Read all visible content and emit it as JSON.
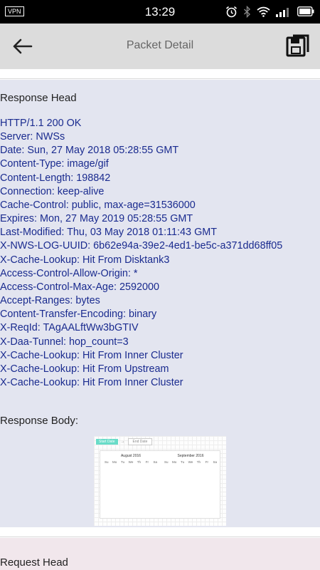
{
  "status_bar": {
    "vpn_label": "VPN",
    "time": "13:29",
    "icons": [
      "alarm-icon",
      "bluetooth-icon",
      "wifi-icon",
      "signal-icon",
      "battery-icon"
    ]
  },
  "app_bar": {
    "title": "Packet Detail",
    "back_icon": "arrow-left-icon",
    "save_icon": "save-icon"
  },
  "response": {
    "head_title": "Response Head",
    "headers": [
      "HTTP/1.1 200 OK",
      "Server: NWSs",
      "Date: Sun, 27 May 2018 05:28:55 GMT",
      "Content-Type: image/gif",
      "Content-Length: 198842",
      "Connection: keep-alive",
      "Cache-Control: public, max-age=31536000",
      "Expires: Mon, 27 May 2019 05:28:55 GMT",
      "Last-Modified: Thu, 03 May 2018 01:11:43 GMT",
      "X-NWS-LOG-UUID: 6b62e94a-39e2-4ed1-be5c-a371dd68ff05",
      "X-Cache-Lookup: Hit From Disktank3",
      "Access-Control-Allow-Origin: *",
      "Access-Control-Max-Age: 2592000",
      "Accept-Ranges: bytes",
      "Content-Transfer-Encoding: binary",
      "X-ReqId: TAgAALftWw3bGTIV",
      "X-Daa-Tunnel: hop_count=3",
      "X-Cache-Lookup: Hit From Inner Cluster",
      "X-Cache-Lookup: Hit From Upstream",
      "X-Cache-Lookup: Hit From Inner Cluster"
    ],
    "body_title": "Response Body:",
    "preview": {
      "start_label": "Start Date",
      "end_label": "End Date",
      "month_left": "August 2016",
      "month_right": "September 2016",
      "weekdays": [
        "Su",
        "Mo",
        "Tu",
        "We",
        "Th",
        "Fr",
        "Sa"
      ]
    }
  },
  "request": {
    "head_title": "Request Head"
  },
  "colors": {
    "response_bg": "#e3e5f0",
    "header_text": "#1a2b8f",
    "request_bg": "#f1e7ec",
    "app_bar_bg": "#dcdcdc",
    "accent": "#69dcc8"
  }
}
